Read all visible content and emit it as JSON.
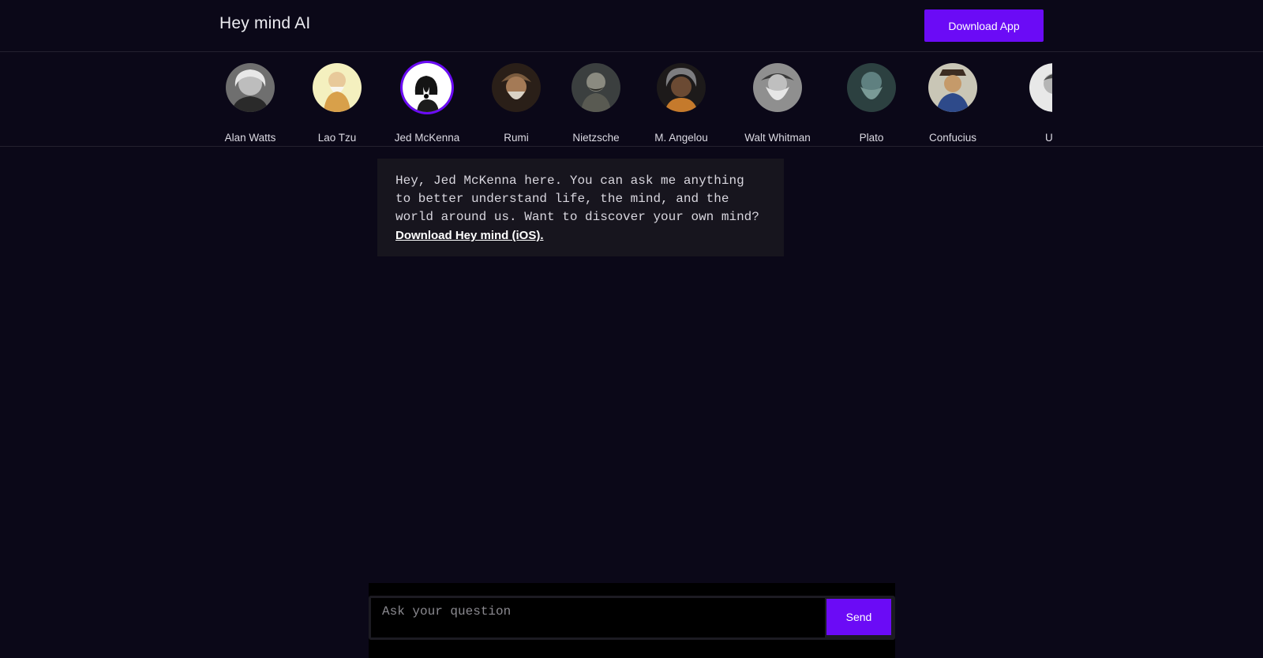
{
  "header": {
    "brand": "Hey mind AI",
    "download_button": "Download App"
  },
  "personas": [
    {
      "name": "Alan Watts",
      "selected": false
    },
    {
      "name": "Lao Tzu",
      "selected": false
    },
    {
      "name": "Jed McKenna",
      "selected": true
    },
    {
      "name": "Rumi",
      "selected": false
    },
    {
      "name": "Nietzsche",
      "selected": false
    },
    {
      "name": "M. Angelou",
      "selected": false
    },
    {
      "name": "Walt Whitman",
      "selected": false
    },
    {
      "name": "Plato",
      "selected": false
    },
    {
      "name": "Confucius",
      "selected": false
    },
    {
      "name": "U.G Krishnamurti",
      "selected": false
    }
  ],
  "chat": {
    "message": "Hey, Jed McKenna here. You can ask me anything to better understand life, the mind, and the world around us. Want to discover your own mind?",
    "link": "Download Hey mind (iOS)."
  },
  "composer": {
    "placeholder": "Ask your question",
    "send_label": "Send"
  },
  "colors": {
    "background": "#0b0818",
    "accent": "#6b0bf6",
    "bubble": "#17151e"
  }
}
